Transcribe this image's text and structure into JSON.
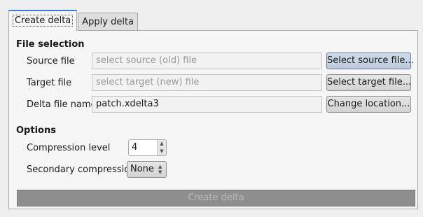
{
  "tabs": [
    {
      "label": "Create delta",
      "active": true
    },
    {
      "label": "Apply delta",
      "active": false
    }
  ],
  "file_selection": {
    "heading": "File selection",
    "source": {
      "label": "Source file",
      "placeholder": "select source (old) file",
      "value": "",
      "button": "Select source file..."
    },
    "target": {
      "label": "Target file",
      "placeholder": "select target (new) file",
      "value": "",
      "button": "Select target file..."
    },
    "delta": {
      "label": "Delta file name",
      "value": "patch.xdelta3",
      "button": "Change location..."
    }
  },
  "options": {
    "heading": "Options",
    "compression_level": {
      "label": "Compression level",
      "value": "4"
    },
    "secondary_compression": {
      "label": "Secondary compression",
      "value": "None"
    }
  },
  "create_button": {
    "label": "Create delta",
    "enabled": false
  },
  "colors": {
    "accent": "#3a7dd6",
    "disabled_button": "#8e8e8e"
  }
}
